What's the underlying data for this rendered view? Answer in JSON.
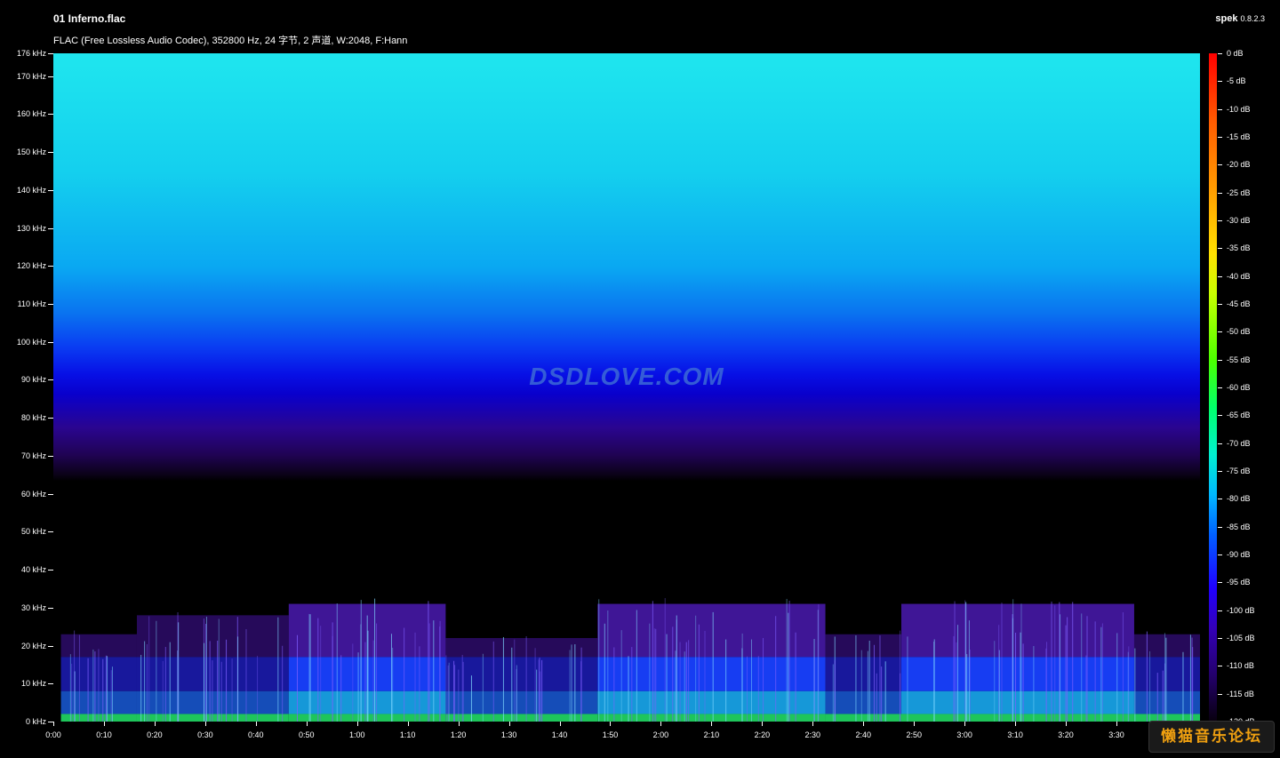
{
  "header": {
    "file_title": "01 Inferno.flac",
    "info": "FLAC (Free Lossless Audio Codec), 352800 Hz, 24 字节, 2 声道, W:2048, F:Hann",
    "app_name": "spek",
    "app_version": "0.8.2.3"
  },
  "spectrogram": {
    "watermark": "DSDLOVE.COM",
    "freq_axis": {
      "max_khz": 176,
      "labels": [
        "176 kHz",
        "170 kHz",
        "160 kHz",
        "150 kHz",
        "140 kHz",
        "130 kHz",
        "120 kHz",
        "110 kHz",
        "100 kHz",
        "90 kHz",
        "80 kHz",
        "70 kHz",
        "60 kHz",
        "50 kHz",
        "40 kHz",
        "30 kHz",
        "20 kHz",
        "10 kHz",
        "0 kHz"
      ],
      "values_khz": [
        176,
        170,
        160,
        150,
        140,
        130,
        120,
        110,
        100,
        90,
        80,
        70,
        60,
        50,
        40,
        30,
        20,
        10,
        0
      ]
    },
    "time_axis": {
      "max_seconds": 226.5,
      "labels": [
        "0:00",
        "0:10",
        "0:20",
        "0:30",
        "0:40",
        "0:50",
        "1:00",
        "1:10",
        "1:20",
        "1:30",
        "1:40",
        "1:50",
        "2:00",
        "2:10",
        "2:20",
        "2:30",
        "2:40",
        "2:50",
        "3:00",
        "3:10",
        "3:20",
        "3:30"
      ],
      "values_seconds": [
        0,
        10,
        20,
        30,
        40,
        50,
        60,
        70,
        80,
        90,
        100,
        110,
        120,
        130,
        140,
        150,
        160,
        170,
        180,
        190,
        200,
        210
      ]
    },
    "noise_floor_start_khz": 64,
    "music_segments": [
      {
        "start": 1.5,
        "end": 16.5,
        "top_khz": 23,
        "style": "dense"
      },
      {
        "start": 16.5,
        "end": 46.5,
        "top_khz": 28,
        "style": "sparse"
      },
      {
        "start": 46.5,
        "end": 77.5,
        "top_khz": 31,
        "style": "loud"
      },
      {
        "start": 77.5,
        "end": 107.5,
        "top_khz": 22,
        "style": "sparse"
      },
      {
        "start": 107.5,
        "end": 152.5,
        "top_khz": 31,
        "style": "loud"
      },
      {
        "start": 152.5,
        "end": 167.5,
        "top_khz": 23,
        "style": "sparse"
      },
      {
        "start": 167.5,
        "end": 213.5,
        "top_khz": 31,
        "style": "loud"
      },
      {
        "start": 213.5,
        "end": 226.5,
        "top_khz": 23,
        "style": "dense"
      }
    ]
  },
  "colorbar": {
    "labels": [
      "0 dB",
      "-5 dB",
      "-10 dB",
      "-15 dB",
      "-20 dB",
      "-25 dB",
      "-30 dB",
      "-35 dB",
      "-40 dB",
      "-45 dB",
      "-50 dB",
      "-55 dB",
      "-60 dB",
      "-65 dB",
      "-70 dB",
      "-75 dB",
      "-80 dB",
      "-85 dB",
      "-90 dB",
      "-95 dB",
      "-100 dB",
      "-105 dB",
      "-110 dB",
      "-115 dB",
      "-120 dB"
    ],
    "min_db": -120,
    "max_db": 0
  },
  "forum_logo": "懒猫音乐论坛"
}
